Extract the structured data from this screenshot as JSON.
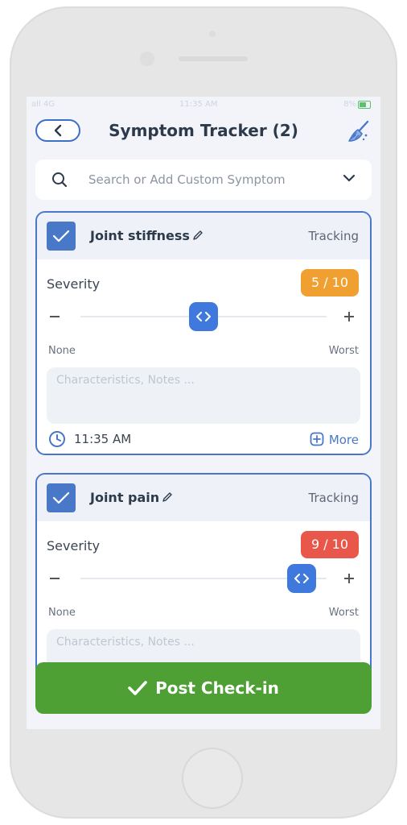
{
  "status_bar": {
    "carrier": "all 4G",
    "time": "11:35 AM",
    "battery_text": "8%"
  },
  "header": {
    "title": "Symptom Tracker (2)"
  },
  "search": {
    "placeholder": "Search or Add Custom Symptom"
  },
  "symptoms": [
    {
      "name": "Joint stiffness",
      "status": "Tracking",
      "severity_label": "Severity",
      "severity_value": 5,
      "severity_text": "5 / 10",
      "severity_color": "#f0a030",
      "min_label": "None",
      "max_label": "Worst",
      "notes_placeholder": "Characteristics, Notes ...",
      "time": "11:35 AM",
      "more_label": "More"
    },
    {
      "name": "Joint pain",
      "status": "Tracking",
      "severity_label": "Severity",
      "severity_value": 9,
      "severity_text": "9 / 10",
      "severity_color": "#e8574a",
      "min_label": "None",
      "max_label": "Worst",
      "notes_placeholder": "Characteristics, Notes ..."
    }
  ],
  "post_button": {
    "label": "Post Check-in",
    "color": "#4e9f34"
  },
  "colors": {
    "accent": "#3d6fc9",
    "background": "#f2f4f9"
  }
}
